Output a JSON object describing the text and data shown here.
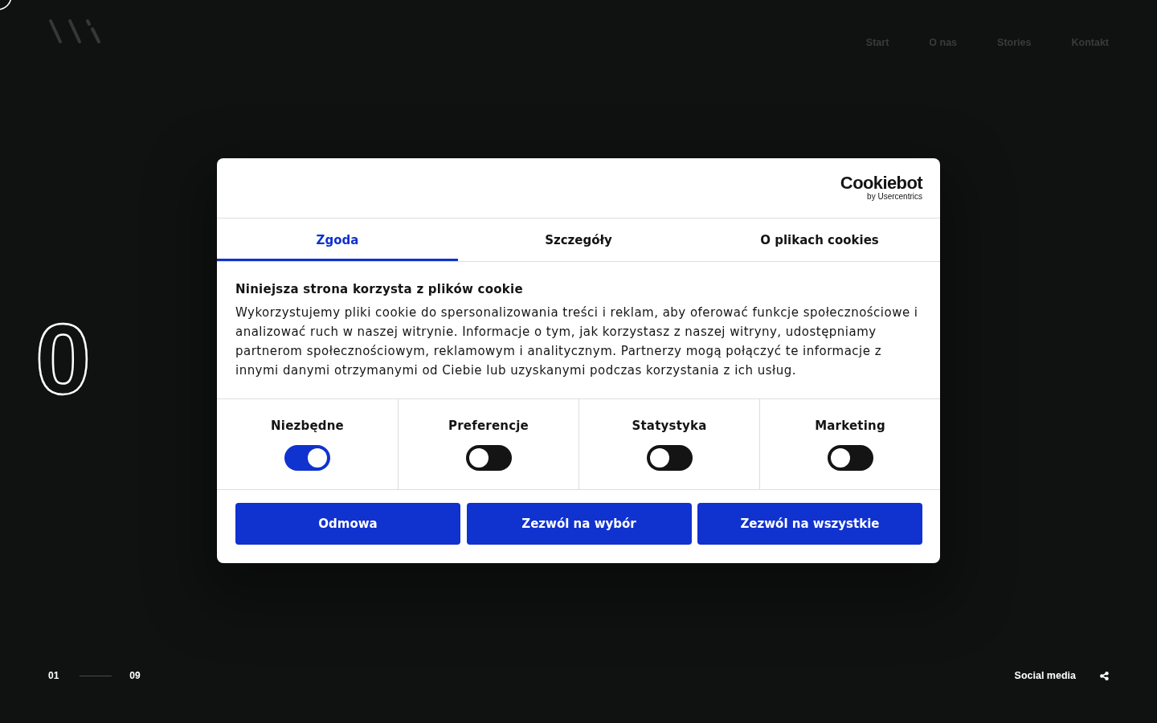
{
  "nav": [
    {
      "label": "Start"
    },
    {
      "label": "O nas"
    },
    {
      "label": "Stories"
    },
    {
      "label": "Kontakt"
    }
  ],
  "hero": {
    "number": "0"
  },
  "cookie_dialog": {
    "brand": {
      "name": "Cookiebot",
      "byline": "by Usercentrics"
    },
    "tabs": [
      {
        "label": "Zgoda",
        "selected": true
      },
      {
        "label": "Szczegóły",
        "selected": false
      },
      {
        "label": "O plikach cookies",
        "selected": false
      }
    ],
    "heading": "Niniejsza strona korzysta z plików cookie",
    "body": "Wykorzystujemy pliki cookie do spersonalizowania treści i reklam, aby oferować funkcje społecznościowe i analizować ruch w naszej witrynie. Informacje o tym, jak korzystasz z naszej witryny, udostępniamy partnerom społecznościowym, reklamowym i analitycznym. Partnerzy mogą połączyć te informacje z innymi danymi otrzymanymi od Ciebie lub uzyskanymi podczas korzystania z ich usług.",
    "categories": [
      {
        "label": "Niezbędne",
        "checked": true
      },
      {
        "label": "Preferencje",
        "checked": false
      },
      {
        "label": "Statystyka",
        "checked": false
      },
      {
        "label": "Marketing",
        "checked": false
      }
    ],
    "buttons": [
      "Odmowa",
      "Zezwól na wybór",
      "Zezwól na wszystkie"
    ]
  },
  "pager": {
    "current": "01",
    "total": "09"
  },
  "social": {
    "label": "Social media"
  }
}
